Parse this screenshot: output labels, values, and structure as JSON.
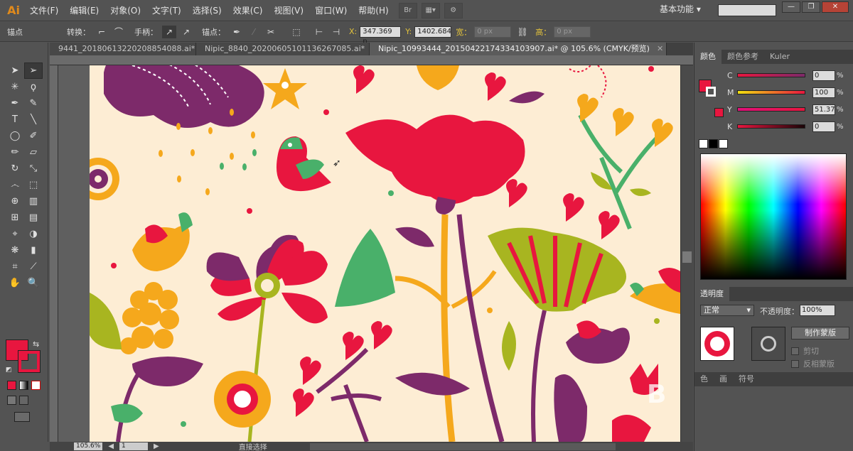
{
  "app": {
    "logo": "Ai",
    "menu": [
      "文件(F)",
      "编辑(E)",
      "对象(O)",
      "文字(T)",
      "选择(S)",
      "效果(C)",
      "视图(V)",
      "窗口(W)",
      "帮助(H)"
    ],
    "menu_icons": [
      "Br"
    ],
    "workspace": "基本功能",
    "window_controls": [
      "—",
      "❐",
      "✕"
    ]
  },
  "control_bar": {
    "tool_name": "锚点",
    "convert_label": "转换：",
    "handles_label": "手柄：",
    "anchors_label": "锚点：",
    "x_label": "X:",
    "x_value": "347.369 p",
    "y_label": "Y:",
    "y_value": "1402.684",
    "width_label": "宽：",
    "width_value": "0 px",
    "height_label": "高：",
    "height_value": "0 px"
  },
  "tabs": [
    {
      "label": "9441_20180613220208854088.ai*",
      "close": "✕",
      "active": false
    },
    {
      "label": "Nipic_8840_20200605101136267085.ai*",
      "close": "✕",
      "active": false
    },
    {
      "label": "Nipic_10993444_20150422174334103907.ai* @ 105.6% (CMYK/预览)",
      "close": "✕",
      "active": true
    }
  ],
  "status": {
    "zoom": "105.6%",
    "page": "1",
    "tool_text": "直接选择"
  },
  "color_panel": {
    "tabs": [
      "颜色",
      "颜色参考",
      "Kuler"
    ],
    "active_tab": "颜色",
    "sliders": [
      {
        "letter": "C",
        "value": "0",
        "color": "#e8163f"
      },
      {
        "letter": "M",
        "value": "100",
        "color": "#e8163f"
      },
      {
        "letter": "Y",
        "value": "51.37",
        "color": "#e8163f"
      },
      {
        "letter": "K",
        "value": "0",
        "color": "#e8163f"
      }
    ],
    "percent_sign": "%"
  },
  "transparency_panel": {
    "title": "透明度",
    "blend_mode": "正常",
    "opacity_label": "不透明度：",
    "opacity_value": "100%",
    "make_mask": "制作蒙版",
    "clip_label": "剪切",
    "invert_label": "反相蒙版"
  },
  "bottom_panel_tabs": [
    "色",
    "画",
    "符号"
  ],
  "colors": {
    "fill": "#e8163f",
    "artboard": "#fdedd4",
    "pink": "#e8163f",
    "purple": "#7d2a6a",
    "orange": "#f5a81c",
    "green": "#49b06a",
    "olive": "#a8b520"
  }
}
